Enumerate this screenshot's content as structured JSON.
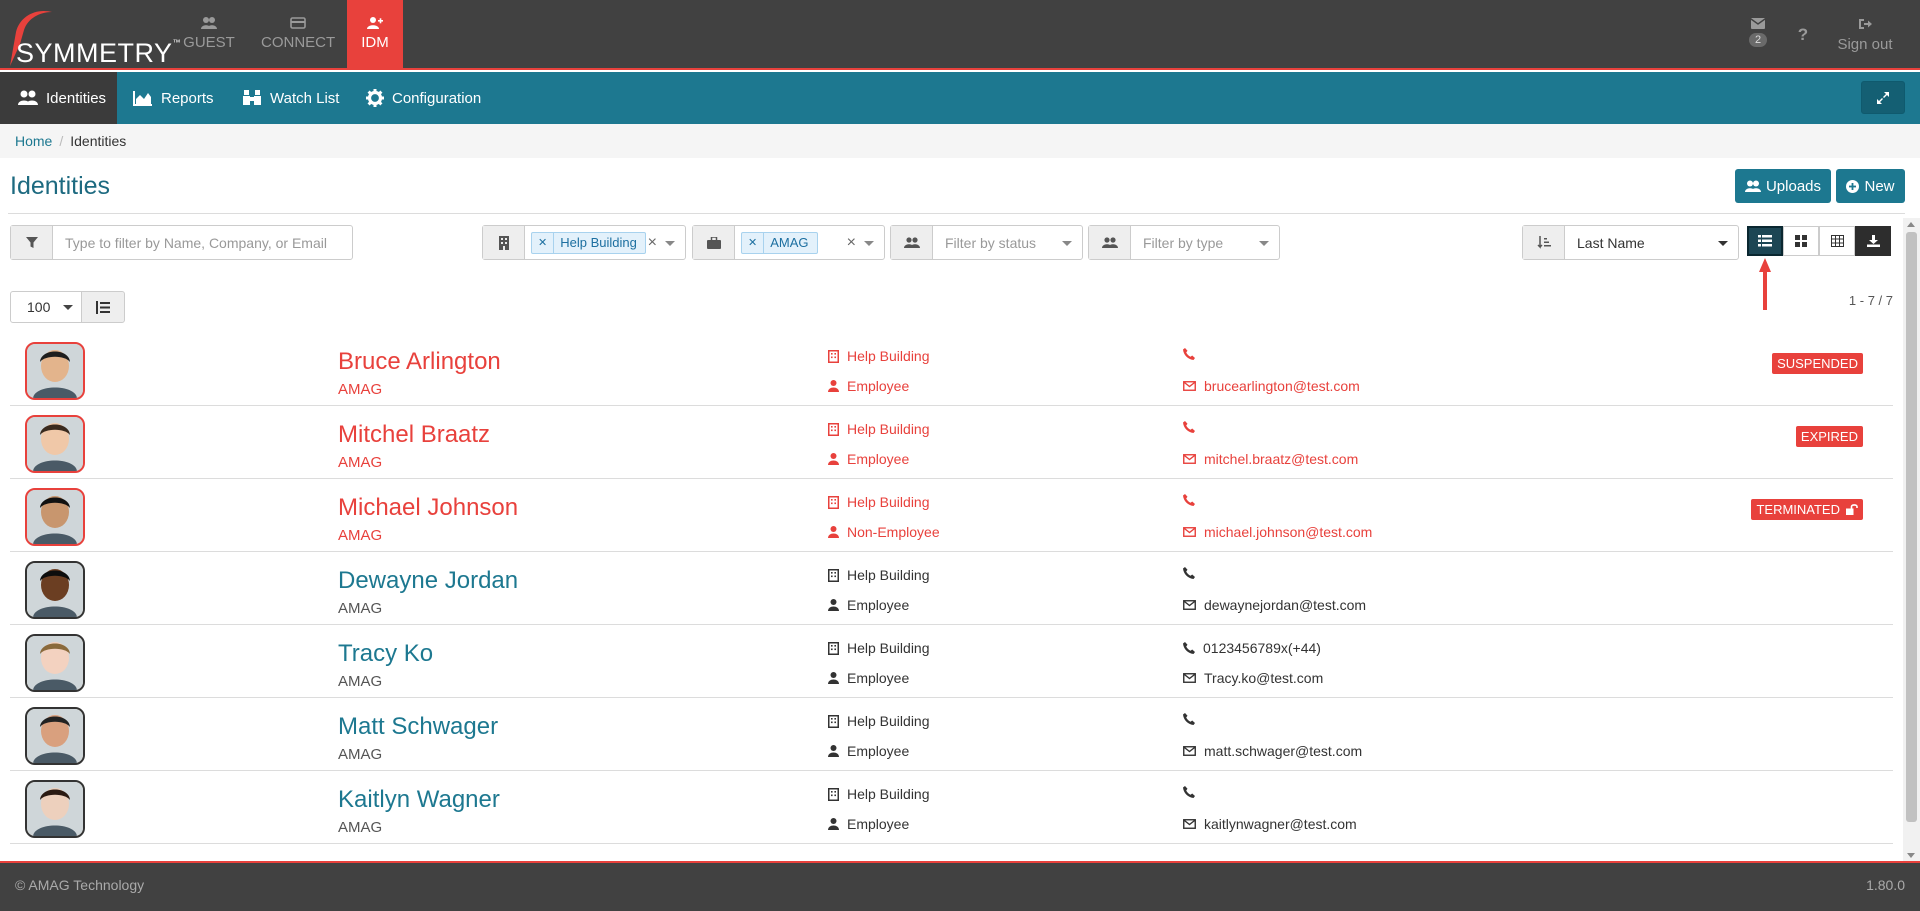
{
  "app": {
    "logo_text": "SYMMETRY",
    "logo_tm": "™",
    "tabs": [
      {
        "label": "GUEST",
        "icon": "users-icon"
      },
      {
        "label": "CONNECT",
        "icon": "card-icon"
      },
      {
        "label": "IDM",
        "icon": "user-plus-icon",
        "active": true
      }
    ],
    "messages_count": "2",
    "help_label": "?",
    "signout_label": "Sign out"
  },
  "nav": {
    "items": [
      {
        "label": "Identities",
        "icon": "users-icon",
        "active": true
      },
      {
        "label": "Reports",
        "icon": "area-chart-icon"
      },
      {
        "label": "Watch List",
        "icon": "binoculars-icon"
      },
      {
        "label": "Configuration",
        "icon": "gear-icon"
      }
    ]
  },
  "breadcrumb": {
    "home": "Home",
    "separator": "/",
    "current": "Identities"
  },
  "page": {
    "title": "Identities",
    "uploads_label": "Uploads",
    "new_label": "New"
  },
  "filters": {
    "search_placeholder": "Type to filter by Name, Company, or Email",
    "building_tag": "Help Building",
    "company_tag": "AMAG",
    "status_placeholder": "Filter by status",
    "type_placeholder": "Filter by type",
    "sort_value": "Last Name",
    "per_page": "100",
    "count": "1 - 7 / 7"
  },
  "identities": [
    {
      "name": "Bruce Arlington",
      "company": "AMAG",
      "building": "Help Building",
      "type": "Employee",
      "phone": "",
      "email": "brucearlington@test.com",
      "status": "SUSPENDED",
      "flagged": true
    },
    {
      "name": "Mitchel Braatz",
      "company": "AMAG",
      "building": "Help Building",
      "type": "Employee",
      "phone": "",
      "email": "mitchel.braatz@test.com",
      "status": "EXPIRED",
      "flagged": true
    },
    {
      "name": "Michael Johnson",
      "company": "AMAG",
      "building": "Help Building",
      "type": "Non-Employee",
      "phone": "",
      "email": "michael.johnson@test.com",
      "status": "TERMINATED",
      "flagged": true
    },
    {
      "name": "Dewayne Jordan",
      "company": "AMAG",
      "building": "Help Building",
      "type": "Employee",
      "phone": "",
      "email": "dewaynejordan@test.com",
      "status": "",
      "flagged": false
    },
    {
      "name": "Tracy Ko",
      "company": "AMAG",
      "building": "Help Building",
      "type": "Employee",
      "phone": "0123456789x(+44)",
      "email": "Tracy.ko@test.com",
      "status": "",
      "flagged": false
    },
    {
      "name": "Matt Schwager",
      "company": "AMAG",
      "building": "Help Building",
      "type": "Employee",
      "phone": "",
      "email": "matt.schwager@test.com",
      "status": "",
      "flagged": false
    },
    {
      "name": "Kaitlyn Wagner",
      "company": "AMAG",
      "building": "Help Building",
      "type": "Employee",
      "phone": "",
      "email": "kaitlynwagner@test.com",
      "status": "",
      "flagged": false
    }
  ],
  "footer": {
    "copyright": "© AMAG Technology",
    "version": "1.80.0"
  },
  "colors": {
    "accent": "#e8413c",
    "teal": "#1d7890",
    "topbar": "#414141"
  }
}
